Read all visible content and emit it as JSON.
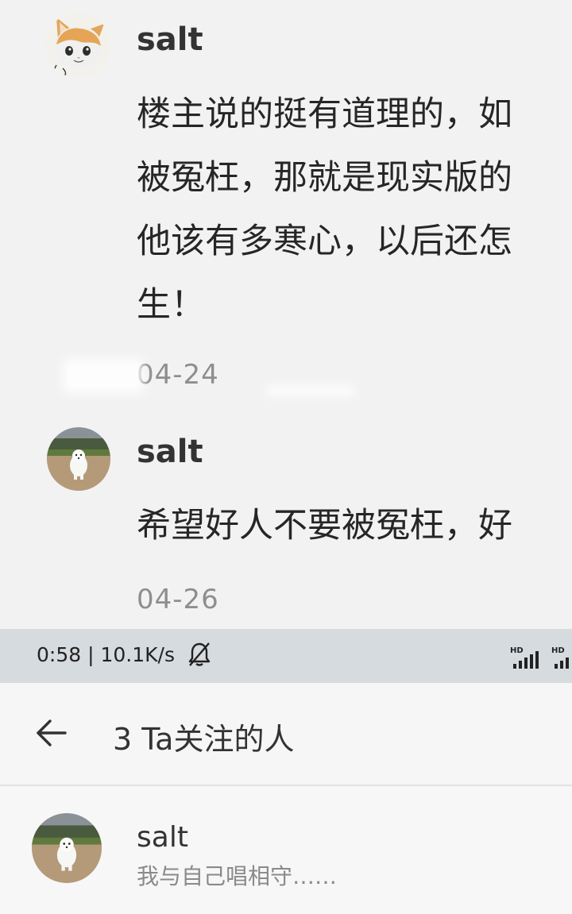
{
  "comments": [
    {
      "user": "salt",
      "avatar": "cat-avatar",
      "lines": [
        "楼主说的挺有道理的，如",
        "被冤枉，那就是现实版的",
        "他该有多寒心，以后还怎",
        "生！"
      ],
      "date": "04-24"
    },
    {
      "user": "salt",
      "avatar": "white-dog-avatar",
      "lines": [
        "希望好人不要被冤枉，好"
      ],
      "date": "04-26"
    }
  ],
  "status_bar": {
    "time_speed": "0:58 | 10.1K/s",
    "silent_icon": "bell-off-icon",
    "signal_icons": [
      "hd-signal-icon",
      "hd-signal-icon"
    ],
    "signal_label": "HD"
  },
  "app_bar": {
    "back_icon": "arrow-left-icon",
    "title": "3 Ta关注的人"
  },
  "following": [
    {
      "name": "salt",
      "bio": "我与自己唱相守……",
      "avatar": "white-dog-avatar"
    }
  ]
}
